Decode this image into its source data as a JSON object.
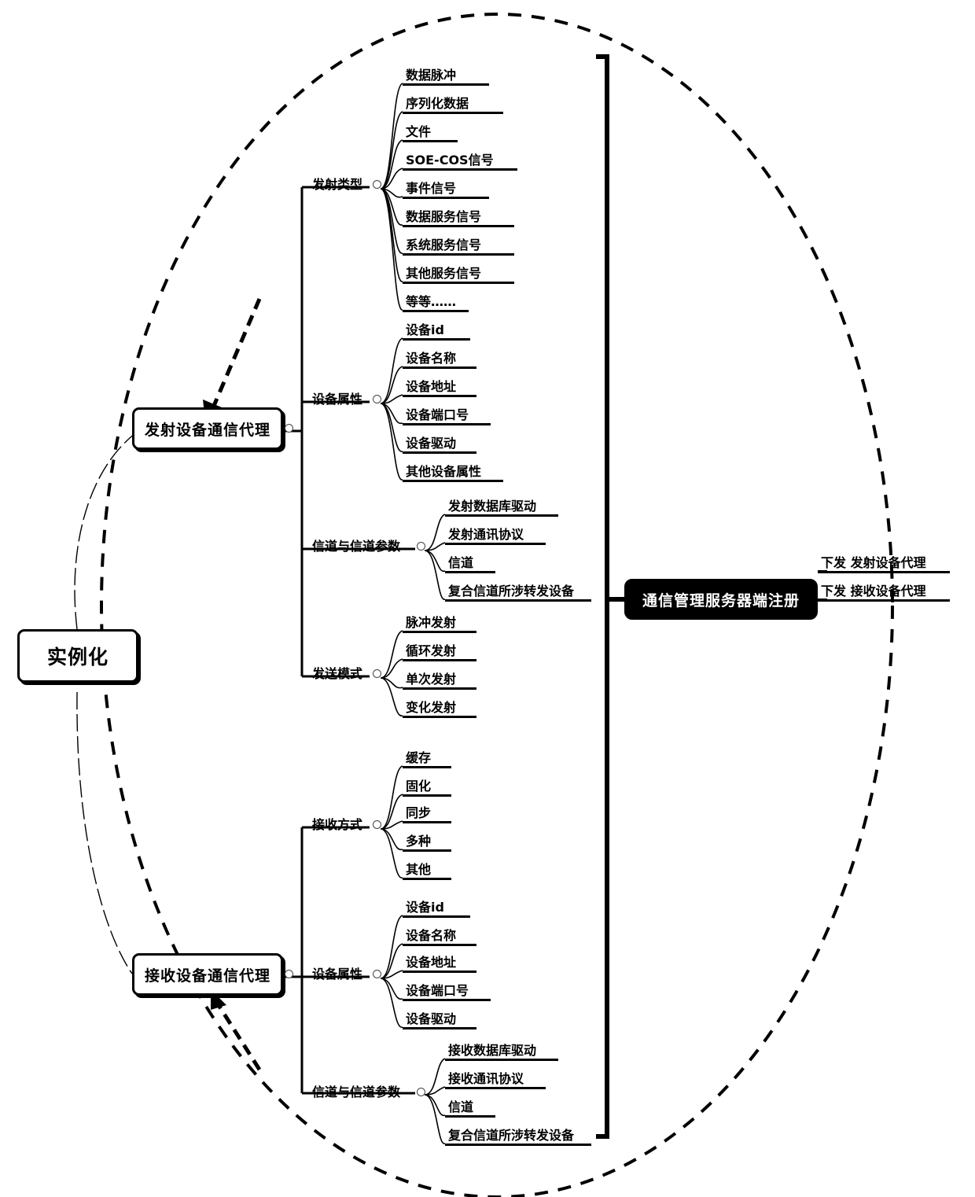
{
  "diagram": {
    "title_nodes": {
      "instantiate": "实例化",
      "transmit_agent": "发射设备通信代理",
      "receive_agent": "接收设备通信代理",
      "server_register": "通信管理服务器端注册"
    },
    "right_items": [
      "下发  发射设备代理",
      "下发  接收设备代理"
    ],
    "transmit": {
      "branches": [
        {
          "label": "发射类型",
          "items": [
            "数据脉冲",
            "序列化数据",
            "文件",
            "SOE-COS信号",
            "事件信号",
            "数据服务信号",
            "系统服务信号",
            "其他服务信号",
            "等等……"
          ]
        },
        {
          "label": "设备属性",
          "items": [
            "设备id",
            "设备名称",
            "设备地址",
            "设备端口号",
            "设备驱动",
            "其他设备属性"
          ]
        },
        {
          "label": "信道与信道参数",
          "items": [
            "发射数据库驱动",
            "发射通讯协议",
            "信道",
            "复合信道所涉转发设备"
          ]
        },
        {
          "label": "发送模式",
          "items": [
            "脉冲发射",
            "循环发射",
            "单次发射",
            "变化发射"
          ]
        }
      ]
    },
    "receive": {
      "branches": [
        {
          "label": "接收方式",
          "items": [
            "缓存",
            "固化",
            "同步",
            "多种",
            "其他"
          ]
        },
        {
          "label": "设备属性",
          "items": [
            "设备id",
            "设备名称",
            "设备地址",
            "设备端口号",
            "设备驱动"
          ]
        },
        {
          "label": "信道与信道参数",
          "items": [
            "接收数据库驱动",
            "接收通讯协议",
            "信道",
            "复合信道所涉转发设备"
          ]
        }
      ]
    },
    "colors": {
      "line": "#000000",
      "background": "#ffffff",
      "dark_node_bg": "#000000",
      "dark_node_text": "#ffffff"
    }
  }
}
